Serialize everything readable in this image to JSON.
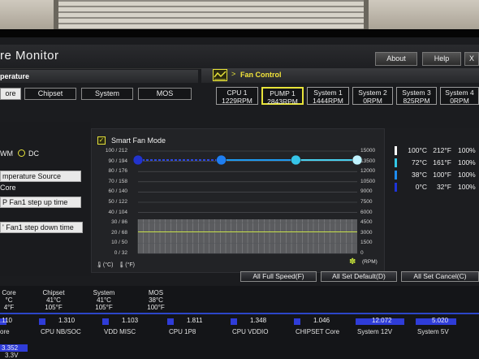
{
  "app": {
    "title": "re Monitor",
    "about": "About",
    "help": "Help",
    "close": "X"
  },
  "temperature": {
    "header": "perature",
    "tabs": [
      "ore",
      "Chipset",
      "System",
      "MOS"
    ]
  },
  "fan_control": {
    "breadcrumb_sep": ">",
    "title": "Fan Control",
    "fans": [
      {
        "name": "CPU 1",
        "value": "1229RPM"
      },
      {
        "name": "PUMP 1",
        "value": "2843RPM"
      },
      {
        "name": "System 1",
        "value": "1444RPM"
      },
      {
        "name": "System 2",
        "value": "0RPM"
      },
      {
        "name": "System 3",
        "value": "825RPM"
      },
      {
        "name": "System 4",
        "value": "0RPM"
      }
    ]
  },
  "left": {
    "mode_pwm": "WM",
    "mode_dc": "DC",
    "temp_source_label": "mperature Source",
    "temp_source_value": "Core",
    "step_up": "P Fan1 step up time",
    "step_down": "' Fan1 step down time"
  },
  "smart_fan": {
    "label": "Smart Fan Mode",
    "unit_c_icon": "thermometer-c-icon",
    "unit_f_icon": "thermometer-f-icon",
    "unit_c": "(°C)",
    "unit_f": "(°F)",
    "rpm_unit": "(RPM)"
  },
  "chart_data": {
    "type": "line",
    "title": "Smart Fan Mode",
    "ylabel_left": "°C / °F",
    "ylabel_right": "RPM",
    "left_ticks": [
      "100 / 212",
      "90 / 194",
      "80 / 176",
      "70 / 158",
      "60 / 140",
      "50 / 122",
      "40 / 104",
      "30 / 86",
      "20 / 68",
      "10 / 50",
      "0 / 32"
    ],
    "right_ticks": [
      "15000",
      "13500",
      "12000",
      "10500",
      "9000",
      "7500",
      "6000",
      "4500",
      "3000",
      "1500",
      "0"
    ],
    "ylim_temp": [
      0,
      100
    ],
    "ylim_rpm": [
      0,
      15000
    ],
    "grid": true,
    "curve_points": [
      {
        "temp_c": 0,
        "percent": 100
      },
      {
        "temp_c": 38,
        "percent": 100
      },
      {
        "temp_c": 72,
        "percent": 100
      },
      {
        "temp_c": 100,
        "percent": 100
      }
    ],
    "history_rpm_level": 5000,
    "history_temp_level": 21
  },
  "legend": [
    {
      "c": "100°C",
      "f": "212°F",
      "pct": "100%",
      "color": "#ffffff"
    },
    {
      "c": "72°C",
      "f": "161°F",
      "pct": "100%",
      "color": "#33c8e6"
    },
    {
      "c": "38°C",
      "f": "100°F",
      "pct": "100%",
      "color": "#1e8cf0"
    },
    {
      "c": "0°C",
      "f": "32°F",
      "pct": "100%",
      "color": "#1e34d8"
    }
  ],
  "buttons": {
    "full_speed": "All Full Speed(F)",
    "set_default": "All Set Default(D)",
    "set_cancel": "All Set Cancel(C)"
  },
  "status_temps": [
    {
      "name": "Core",
      "c": "°C",
      "f": "4°F"
    },
    {
      "name": "Chipset",
      "c": "41°C",
      "f": "105°F"
    },
    {
      "name": "System",
      "c": "41°C",
      "f": "105°F"
    },
    {
      "name": "MOS",
      "c": "38°C",
      "f": "100°F"
    }
  ],
  "voltages": [
    {
      "value": ".110",
      "name": "ore"
    },
    {
      "value": "1.310",
      "name": "CPU NB/SOC"
    },
    {
      "value": "1.103",
      "name": "VDD MISC"
    },
    {
      "value": "1.811",
      "name": "CPU 1P8"
    },
    {
      "value": "1.348",
      "name": "CPU VDDIO"
    },
    {
      "value": "1.046",
      "name": "CHIPSET Core"
    },
    {
      "value": "12.072",
      "name": "System 12V"
    },
    {
      "value": "5.020",
      "name": "System 5V"
    }
  ],
  "v33": {
    "value": "3.352",
    "name": "3.3V"
  },
  "colors": {
    "accent": "#e7e33a",
    "bar_blue": "#2f3cd8"
  }
}
